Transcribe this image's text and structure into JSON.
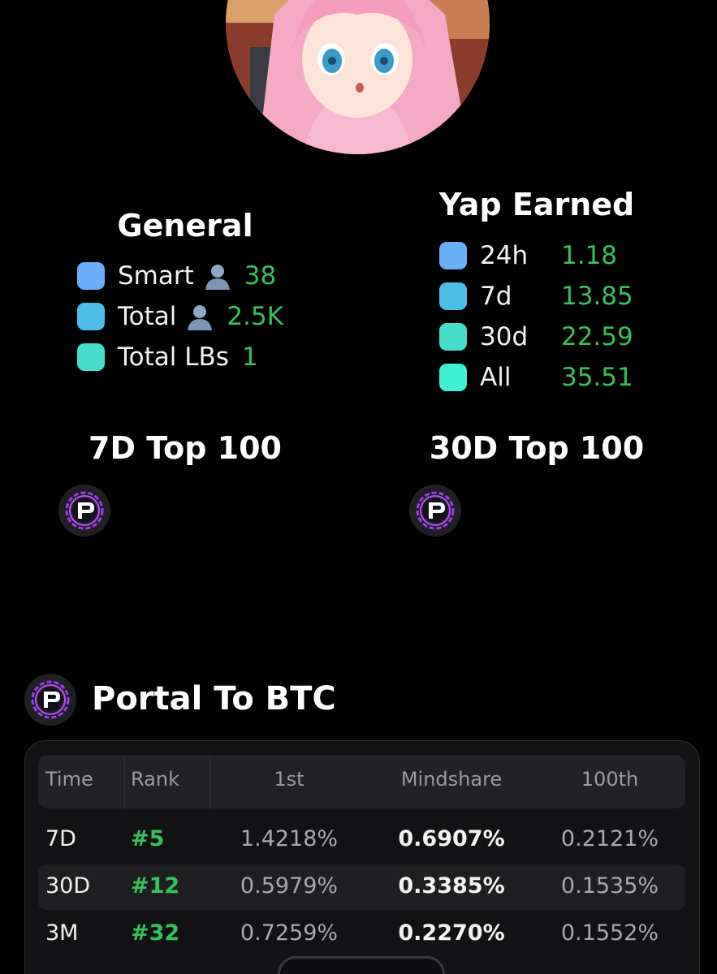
{
  "general": {
    "title": "General",
    "rows": [
      {
        "label": "Smart",
        "value": "38",
        "color": "#6aaef7"
      },
      {
        "label": "Total",
        "value": "2.5K",
        "color": "#4cbde6"
      },
      {
        "label": "Total LBs",
        "value": "1",
        "color": "#45dcc9"
      }
    ]
  },
  "yap_earned": {
    "title": "Yap Earned",
    "rows": [
      {
        "label": "24h",
        "value": "1.18",
        "color": "#6aaef7"
      },
      {
        "label": "7d",
        "value": "13.85",
        "color": "#4cbde6"
      },
      {
        "label": "30d",
        "value": "22.59",
        "color": "#45dcc9"
      },
      {
        "label": "All",
        "value": "35.51",
        "color": "#3ff0d2"
      }
    ]
  },
  "top100_7d": {
    "title": "7D Top 100"
  },
  "top100_30d": {
    "title": "30D Top 100"
  },
  "portal": {
    "title": "Portal To BTC",
    "headers": {
      "time": "Time",
      "rank": "Rank",
      "first": "1st",
      "mindshare": "Mindshare",
      "hundredth": "100th"
    },
    "rows": [
      {
        "time": "7D",
        "rank": "#5",
        "first": "1.4218%",
        "mindshare": "0.6907%",
        "hundredth": "0.2121%"
      },
      {
        "time": "30D",
        "rank": "#12",
        "first": "0.5979%",
        "mindshare": "0.3385%",
        "hundredth": "0.1535%"
      },
      {
        "time": "3M",
        "rank": "#32",
        "first": "0.7259%",
        "mindshare": "0.2270%",
        "hundredth": "0.1552%"
      }
    ]
  },
  "colors": {
    "accent_green": "#36c15d",
    "background": "#000000"
  },
  "icons": {
    "person": "person-silhouette-icon",
    "project_logo": "portal-logo-icon"
  }
}
